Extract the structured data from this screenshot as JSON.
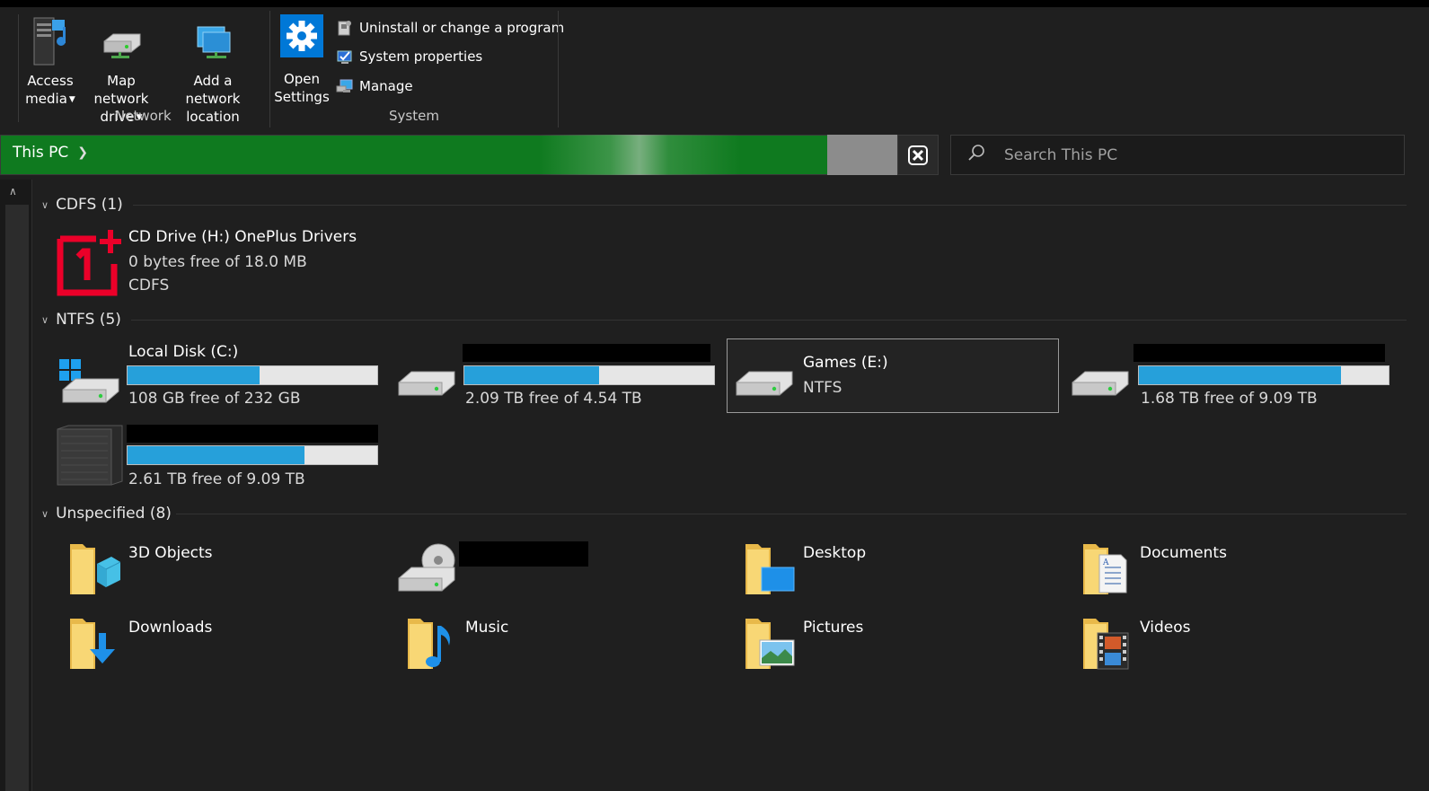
{
  "ribbon": {
    "network_group": {
      "label": "Network",
      "buttons": [
        {
          "line1": "Access",
          "line2": "media",
          "has_dropdown": true
        },
        {
          "line1": "Map network",
          "line2": "drive",
          "has_dropdown": true
        },
        {
          "line1": "Add a network",
          "line2": "location",
          "has_dropdown": false
        }
      ]
    },
    "system_group": {
      "label": "System",
      "open_settings": {
        "line1": "Open",
        "line2": "Settings"
      },
      "small_buttons": [
        "Uninstall or change a program",
        "System properties",
        "Manage"
      ]
    },
    "colors": {
      "settings_blue": "#0078d7"
    }
  },
  "address_bar": {
    "breadcrumb": "This PC",
    "separator": ">",
    "background": "#0f7a1f"
  },
  "search": {
    "placeholder": "Search This PC"
  },
  "groups": {
    "cdfs": {
      "title": "CDFS (1)"
    },
    "ntfs": {
      "title": "NTFS (5)"
    },
    "unspecified": {
      "title": "Unspecified (8)"
    }
  },
  "cdfs_drive": {
    "name": "CD Drive (H:) OnePlus Drivers",
    "free": "0 bytes free of 18.0 MB",
    "fs": "CDFS"
  },
  "ntfs_drives": [
    {
      "name": "Local Disk (C:)",
      "free": "108 GB free of 232 GB",
      "used_fraction": 0.53
    },
    {
      "name": "",
      "free": "2.09 TB free of 4.54 TB",
      "used_fraction": 0.54
    },
    {
      "name": "Games (E:)",
      "fs": "NTFS"
    },
    {
      "name": "",
      "free": "1.68 TB free of 9.09 TB",
      "used_fraction": 0.81
    },
    {
      "name": "",
      "free": "2.61 TB free of 9.09 TB",
      "used_fraction": 0.71
    }
  ],
  "folders": [
    {
      "name": "3D Objects"
    },
    {
      "name": ""
    },
    {
      "name": "Desktop"
    },
    {
      "name": "Documents"
    },
    {
      "name": "Downloads"
    },
    {
      "name": "Music"
    },
    {
      "name": "Pictures"
    },
    {
      "name": "Videos"
    }
  ],
  "colors": {
    "bar_fill": "#26a0da",
    "bar_bg": "#e6e6e6",
    "oneplus_red": "#eb0029",
    "folder_yellow": "#f8d775"
  }
}
